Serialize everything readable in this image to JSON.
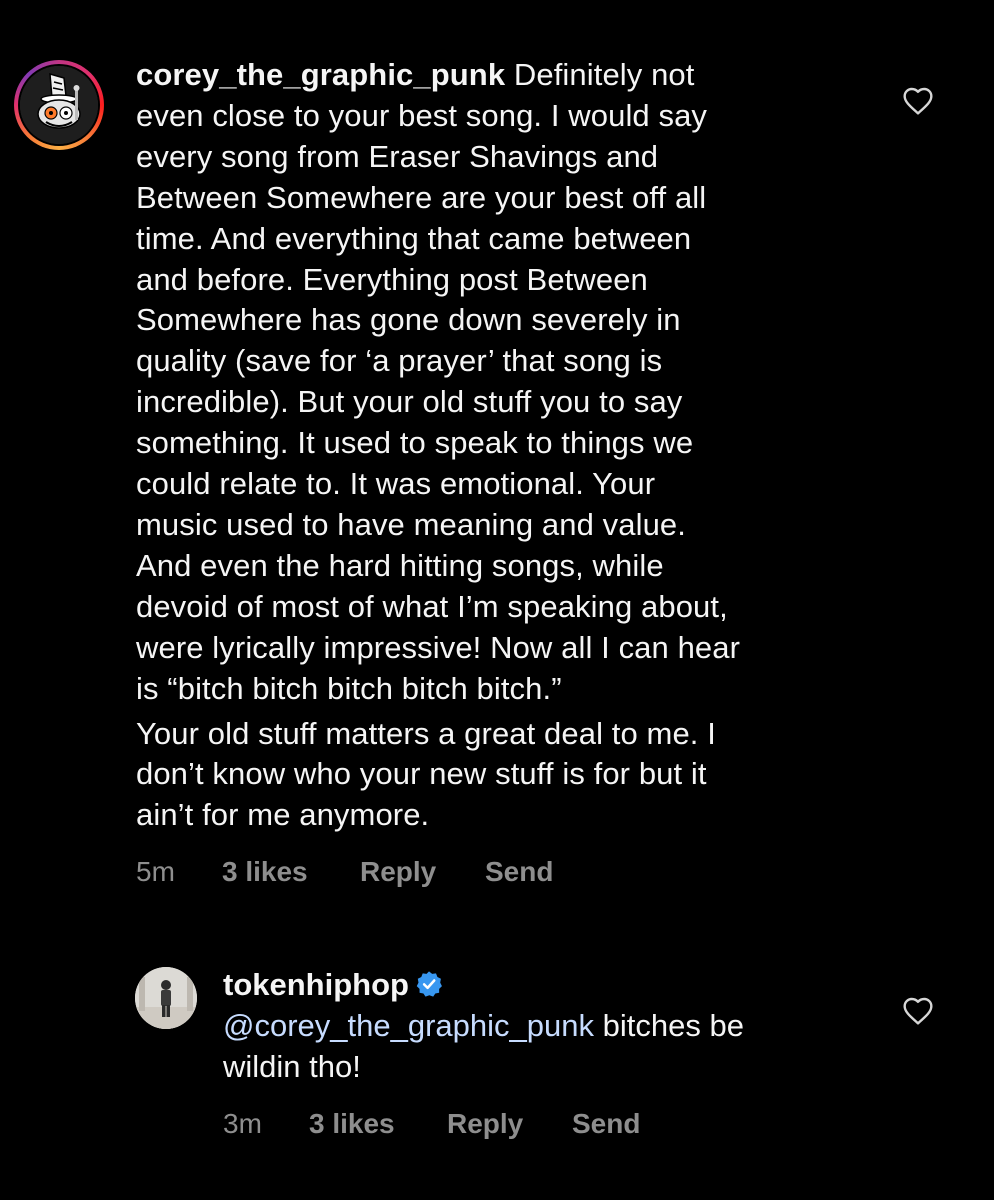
{
  "comment": {
    "username": "corey_the_graphic_punk",
    "text_para1": " Definitely not\neven close to your best song. I would say\nevery song from Eraser Shavings and\nBetween Somewhere are your best off all\ntime. And everything that came between\nand before. Everything post Between\nSomewhere has gone down severely in\nquality (save for ‘a prayer’ that song is\nincredible). But your old stuff you to say\nsomething. It used to speak to things we\ncould relate to. It was emotional. Your\nmusic used to have meaning and value.\nAnd even the hard hitting songs, while\ndevoid of most of what I’m speaking about,\nwere lyrically impressive! Now all I can hear\nis “bitch bitch bitch bitch bitch.”",
    "text_para2": "Your old stuff matters a great deal to me. I\ndon’t know who your new stuff is for but it\nain’t for me anymore.",
    "time": "5m",
    "likes": "3 likes",
    "reply_label": "Reply",
    "send_label": "Send",
    "like_icon": "heart-outline-icon",
    "avatar_ring_colors": [
      "#c13584",
      "#e1306c",
      "#fd1d1d",
      "#f77737",
      "#fcaf45",
      "#833ab4"
    ]
  },
  "reply": {
    "username": "tokenhiphop",
    "verified_icon": "verified-badge-icon",
    "verified_color": "#3897f0",
    "mention": "@corey_the_graphic_punk",
    "text": " bitches be\nwildin tho!",
    "time": "3m",
    "likes": "3 likes",
    "reply_label": "Reply",
    "send_label": "Send",
    "like_icon": "heart-outline-icon"
  },
  "colors": {
    "background": "#000000",
    "text": "#f5f5f5",
    "meta": "#8e8e8e"
  }
}
